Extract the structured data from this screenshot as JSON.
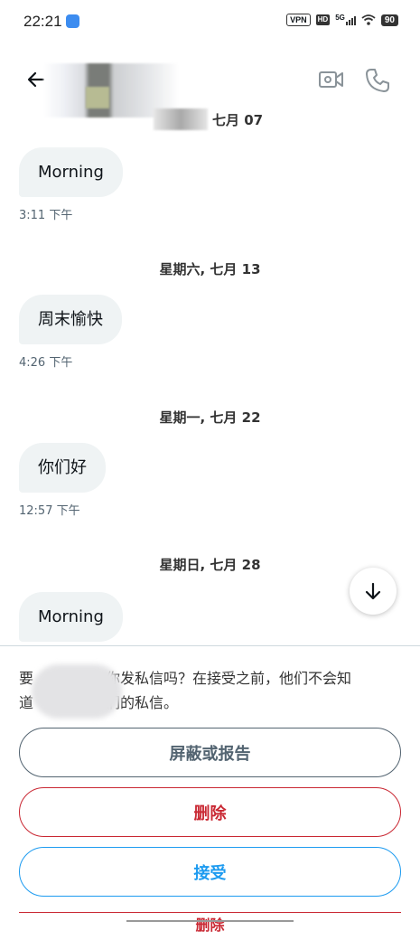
{
  "status_bar": {
    "time": "22:21",
    "vpn": "VPN",
    "hd": "HD",
    "network": "5G",
    "battery": "90"
  },
  "header": {
    "back_icon": "arrow-left-icon",
    "video_icon": "video-call-icon",
    "phone_icon": "phone-icon"
  },
  "conversation": {
    "groups": [
      {
        "date": "七月 07",
        "message": "Morning",
        "time": "3:11 下午"
      },
      {
        "date": "星期六, 七月 13",
        "message": "周末愉快",
        "time": "4:26 下午"
      },
      {
        "date": "星期一, 七月 22",
        "message": "你们好",
        "time": "12:57 下午"
      },
      {
        "date": "星期日, 七月 28",
        "message": "Morning"
      }
    ]
  },
  "request_panel": {
    "notice_line1": "要　　　　　你发私信吗？在接受之前，他们不会知",
    "notice_line2": "道　　　　　们的私信。",
    "block_label": "屏蔽或报告",
    "delete_label": "删除",
    "accept_label": "接受"
  },
  "colors": {
    "bubble": "#eff3f4",
    "accent": "#1d9bf0",
    "danger": "#c92833",
    "muted": "#536471"
  }
}
